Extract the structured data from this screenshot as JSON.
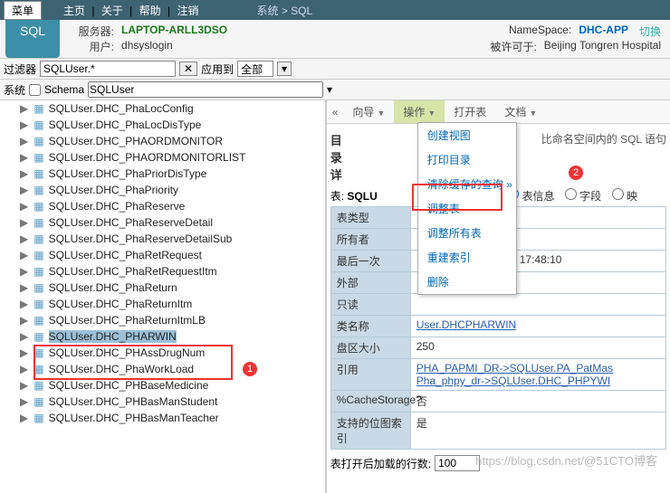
{
  "top": {
    "menu": "菜单",
    "links": [
      "主页",
      "关于",
      "帮助",
      "注销"
    ],
    "crumb_sys": "系统",
    "crumb_page": "SQL"
  },
  "title": "SQL",
  "meta": {
    "server_label": "服务器:",
    "server": "LAPTOP-ARLL3DSO",
    "ns_label": "NameSpace:",
    "ns": "DHC-APP",
    "swap": "切换",
    "user_label": "用户:",
    "user": "dhsyslogin",
    "perm_label": "被许可于:",
    "perm": "Beijing Tongren Hospital"
  },
  "filter": {
    "label": "过滤器",
    "value": "SQLUser.*",
    "apply": "应用到",
    "scope": "全部"
  },
  "sys": {
    "label": "系统",
    "schema_label": "Schema",
    "schema": "SQLUser"
  },
  "tree": [
    "SQLUser.DHC_PhaLocConfig",
    "SQLUser.DHC_PhaLocDisType",
    "SQLUser.DHC_PHAORDMONITOR",
    "SQLUser.DHC_PHAORDMONITORLIST",
    "SQLUser.DHC_PhaPriorDisType",
    "SQLUser.DHC_PhaPriority",
    "SQLUser.DHC_PhaReserve",
    "SQLUser.DHC_PhaReserveDetail",
    "SQLUser.DHC_PhaReserveDetailSub",
    "SQLUser.DHC_PhaRetRequest",
    "SQLUser.DHC_PhaRetRequestItm",
    "SQLUser.DHC_PhaReturn",
    "SQLUser.DHC_PhaReturnItm",
    "SQLUser.DHC_PhaReturnItmLB",
    "SQLUser.DHC_PHARWIN",
    "SQLUser.DHC_PHAssDrugNum",
    "SQLUser.DHC_PhaWorkLoad",
    "SQLUser.DHC_PHBaseMedicine",
    "SQLUser.DHC_PHBasManStudent",
    "SQLUser.DHC_PHBasManTeacher"
  ],
  "tree_selected_index": 14,
  "tabs": {
    "guide": "向导",
    "action": "操作",
    "open": "打开表",
    "doc": "文档"
  },
  "dropdown": [
    "创建视图",
    "打印目录",
    "清除缓存的查询 »",
    "调整表",
    "调整所有表",
    "重建索引",
    "删除"
  ],
  "detail": {
    "head": "目录详",
    "tip": "比命名空间内的 SQL 语句",
    "table_label": "表:",
    "table": "SQLU",
    "radios": {
      "info": "表信息",
      "field": "字段",
      "map": "映"
    },
    "rows": {
      "type_k": "表类型",
      "type_v": "",
      "owner_k": "所有者",
      "owner_v": "",
      "last_k": "最后一次",
      "last_v": "17:48:10",
      "ext_k": "外部",
      "ext_v": "",
      "ro_k": "只读",
      "ro_v": "",
      "cls_k": "类名称",
      "cls_v": "User.DHCPHARWIN",
      "ext2_k": "盘区大小",
      "ext2_v": "250",
      "ref_k": "引用",
      "ref_v1": "PHA_PAPMI_DR->SQLUser.PA_PatMas",
      "ref_v2": "Pha_phpy_dr->SQLUser.DHC_PHPYWI",
      "cs_k": "%CacheStorage?",
      "cs_v": "否",
      "bmp_k": "支持的位图索引",
      "bmp_v": "是"
    },
    "foot_label": "表打开后加载的行数:",
    "foot_val": "100"
  },
  "badges": {
    "b1": "1",
    "b2": "2"
  },
  "watermark": "https://blog.csdn.net/@51CTO博客"
}
